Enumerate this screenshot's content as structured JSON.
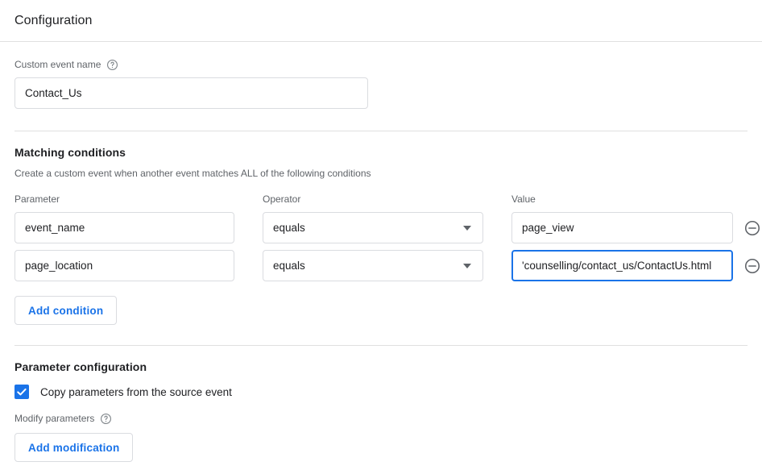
{
  "header": {
    "title": "Configuration"
  },
  "custom_event": {
    "label": "Custom event name",
    "help_icon": "help-circle-icon",
    "value": "Contact_Us"
  },
  "matching_conditions": {
    "title": "Matching conditions",
    "description": "Create a custom event when another event matches ALL of the following conditions",
    "columns": {
      "parameter": "Parameter",
      "operator": "Operator",
      "value": "Value"
    },
    "rows": [
      {
        "parameter": "event_name",
        "operator": "equals",
        "value": "page_view",
        "focused": false,
        "remove_icon": "remove-circle-icon"
      },
      {
        "parameter": "page_location",
        "operator": "equals",
        "value": "'counselling/contact_us/ContactUs.html",
        "focused": true,
        "remove_icon": "remove-circle-icon"
      }
    ],
    "add_condition_label": "Add condition"
  },
  "parameter_configuration": {
    "title": "Parameter configuration",
    "copy_parameters_label": "Copy parameters from the source event",
    "copy_parameters_checked": true,
    "modify_parameters_label": "Modify parameters",
    "modify_parameters_help_icon": "help-circle-icon",
    "add_modification_label": "Add modification"
  },
  "colors": {
    "accent": "#1a73e8",
    "text_primary": "#202124",
    "text_secondary": "#5f6368",
    "border": "#dadce0",
    "divider": "#e0e0e0"
  }
}
